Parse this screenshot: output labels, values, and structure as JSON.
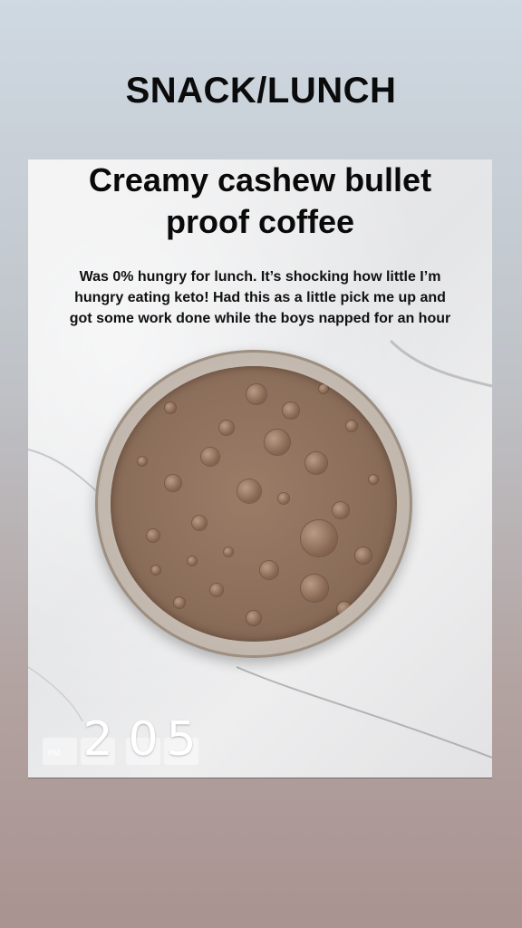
{
  "header": {
    "title": "SNACK/LUNCH"
  },
  "card": {
    "title_line1": "Creamy cashew bullet",
    "title_line2": "proof coffee",
    "caption_line1": "Was 0% hungry for lunch. It’s shocking how little I’m",
    "caption_line2": "hungry eating keto! Had this as a little pick me up and",
    "caption_line3": "got some work done while the boys napped for an hour"
  },
  "clock": {
    "ampm": "PM",
    "hour_digit": "2",
    "minute_tens": "0",
    "minute_ones": "5"
  },
  "colors": {
    "header_text": "#0b0b0b",
    "coffee": "#8c6f5b",
    "marble": "#e8e8ea"
  }
}
